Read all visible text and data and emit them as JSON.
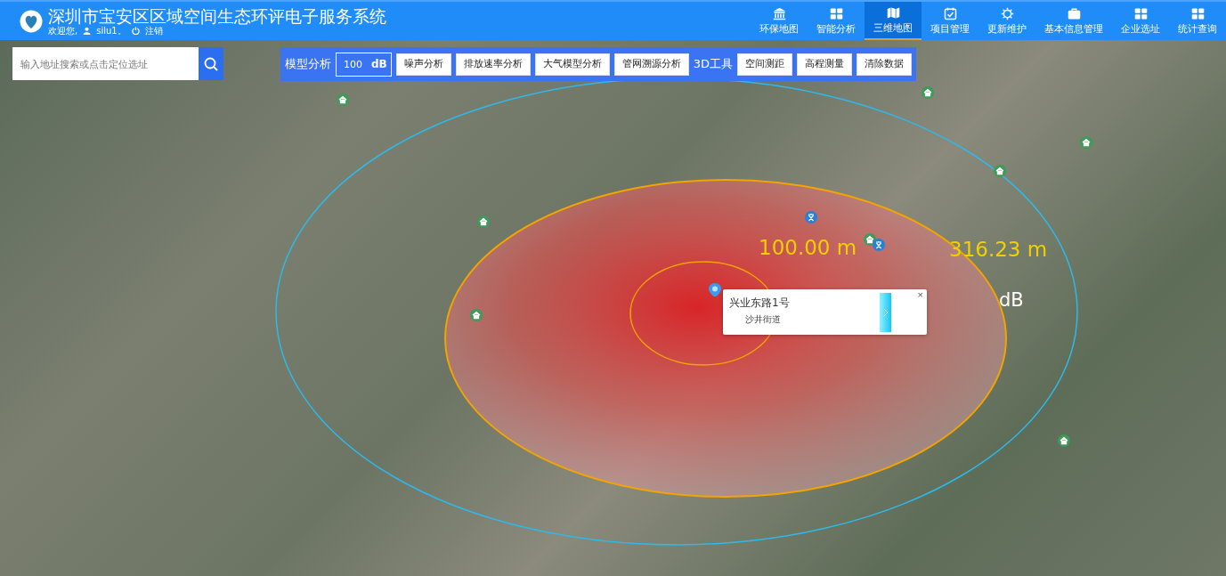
{
  "header": {
    "title": "深圳市宝安区区域空间生态环评电子服务系统",
    "welcome": "欢迎您,",
    "user": "silu1。",
    "logout": "注销"
  },
  "nav": [
    {
      "label": "环保地图",
      "kind": "bank",
      "selected": false
    },
    {
      "label": "智能分析",
      "kind": "grid",
      "selected": false
    },
    {
      "label": "三维地图",
      "kind": "map",
      "selected": true
    },
    {
      "label": "项目管理",
      "kind": "calendar",
      "selected": false
    },
    {
      "label": "更新维护",
      "kind": "gear",
      "selected": false
    },
    {
      "label": "基本信息管理",
      "kind": "briefcase",
      "selected": false
    },
    {
      "label": "企业选址",
      "kind": "grid",
      "selected": false
    },
    {
      "label": "统计查询",
      "kind": "grid",
      "selected": false
    }
  ],
  "search": {
    "placeholder": "输入地址搜索或点击定位选址"
  },
  "toolbar": {
    "model_label": "模型分析",
    "db_value": "100",
    "db_unit": "dB",
    "model_buttons": [
      "噪声分析",
      "排放速率分析",
      "大气模型分析",
      "管网溯源分析"
    ],
    "tools_label": "3D工具",
    "tool_buttons": [
      "空间测距",
      "高程测量",
      "清除数据"
    ]
  },
  "map": {
    "distance_labels": [
      "100.00 m",
      "316.23 m"
    ],
    "partial_label": "dB",
    "popup": {
      "title": "兴业东路1号",
      "subtitle": "沙井街道",
      "close": "×"
    }
  }
}
